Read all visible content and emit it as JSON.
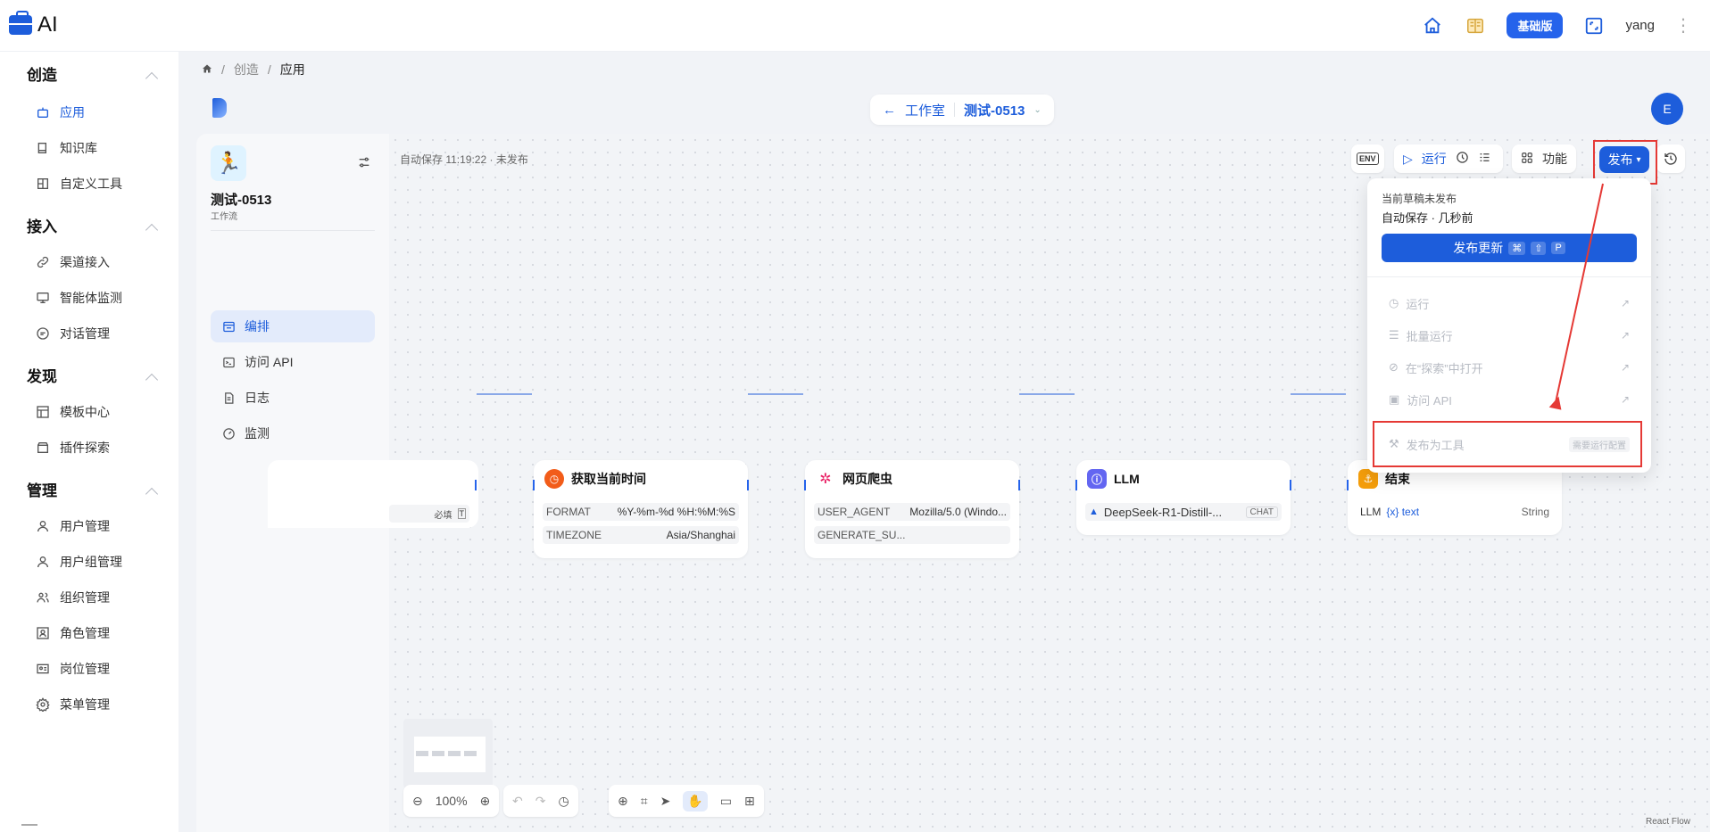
{
  "topbar": {
    "logo_text": "AI",
    "plan_badge": "基础版",
    "user_name": "yang"
  },
  "sidebar": {
    "groups": [
      {
        "title": "创造",
        "items": [
          {
            "label": "应用",
            "icon": "robot-icon",
            "active": true
          },
          {
            "label": "知识库",
            "icon": "book-icon"
          },
          {
            "label": "自定义工具",
            "icon": "tool-icon"
          }
        ]
      },
      {
        "title": "接入",
        "items": [
          {
            "label": "渠道接入",
            "icon": "link-icon"
          },
          {
            "label": "智能体监测",
            "icon": "monitor-icon"
          },
          {
            "label": "对话管理",
            "icon": "chat-icon"
          }
        ]
      },
      {
        "title": "发现",
        "items": [
          {
            "label": "模板中心",
            "icon": "template-icon"
          },
          {
            "label": "插件探索",
            "icon": "store-icon"
          }
        ]
      },
      {
        "title": "管理",
        "items": [
          {
            "label": "用户管理",
            "icon": "user-icon"
          },
          {
            "label": "用户组管理",
            "icon": "user-group-icon"
          },
          {
            "label": "组织管理",
            "icon": "org-icon"
          },
          {
            "label": "角色管理",
            "icon": "role-icon"
          },
          {
            "label": "岗位管理",
            "icon": "post-icon"
          },
          {
            "label": "菜单管理",
            "icon": "menu-gear-icon"
          }
        ]
      }
    ]
  },
  "breadcrumb": {
    "items": [
      "创造",
      "应用"
    ]
  },
  "header": {
    "back_label": "工作室",
    "project_name": "测试-0513",
    "avatar_letter": "E"
  },
  "panel": {
    "app_name": "测试-0513",
    "app_type": "工作流",
    "items": [
      {
        "label": "编排",
        "active": true
      },
      {
        "label": "访问 API"
      },
      {
        "label": "日志"
      },
      {
        "label": "监测"
      }
    ]
  },
  "canvas": {
    "autosave_text": "自动保存 11:19:22 · 未发布",
    "toolbar": {
      "env_label": "ENV",
      "run_label": "运行",
      "features_label": "功能",
      "publish_label": "发布"
    },
    "nodes": {
      "start": {
        "required_label": "必填"
      },
      "time": {
        "title": "获取当前时间",
        "rows": [
          {
            "k": "FORMAT",
            "v": "%Y-%m-%d %H:%M:%S"
          },
          {
            "k": "TIMEZONE",
            "v": "Asia/Shanghai"
          }
        ]
      },
      "crawler": {
        "title": "网页爬虫",
        "rows": [
          {
            "k": "USER_AGENT",
            "v": "Mozilla/5.0 (Windo..."
          },
          {
            "k": "GENERATE_SU...",
            "v": ""
          }
        ]
      },
      "llm": {
        "title": "LLM",
        "model": "DeepSeek-R1-Distill-...",
        "tag": "CHAT"
      },
      "end": {
        "title": "结束",
        "src": "LLM",
        "var": "{x} text",
        "type": "String"
      }
    },
    "zoom": "100%",
    "attribution": "React Flow"
  },
  "publish_menu": {
    "status": "当前草稿未发布",
    "autosave": "自动保存 · 几秒前",
    "update_label": "发布更新",
    "keys": [
      "⌘",
      "⇧",
      "P"
    ],
    "items": [
      {
        "label": "运行",
        "icon": "play-circle-icon"
      },
      {
        "label": "批量运行",
        "icon": "batch-icon"
      },
      {
        "label": "在“探索”中打开",
        "icon": "compass-icon"
      },
      {
        "label": "访问 API",
        "icon": "terminal-icon"
      }
    ],
    "tool_label": "发布为工具",
    "tool_note": "需要运行配置"
  }
}
